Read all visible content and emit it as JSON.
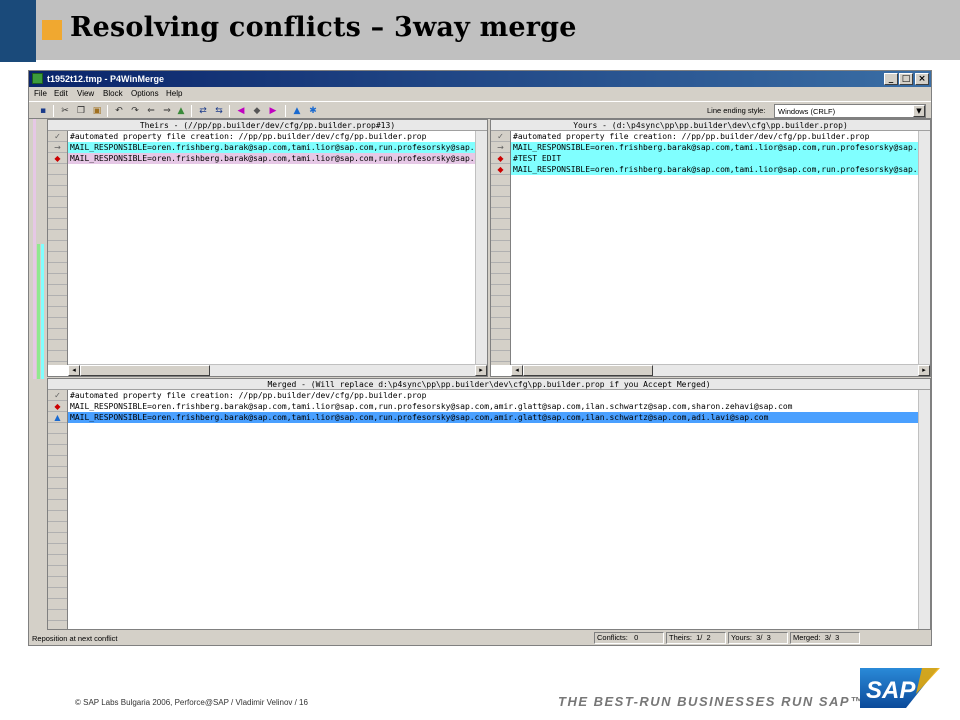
{
  "slide": {
    "title": "Resolving conflicts – 3way merge",
    "footer": "© SAP Labs Bulgaria 2006, Perforce@SAP / Vladimir Velinov / 16",
    "slogan": "THE BEST-RUN BUSINESSES RUN SAP™",
    "logo_text": "SAP",
    "colors": {
      "header_gray": "#c0c0c0",
      "header_blue": "#1a4a7a",
      "header_orange": "#f0a830",
      "sap_blue": "#1763b0",
      "sap_orange": "#f0ab00"
    }
  },
  "window": {
    "title": "t1952t12.tmp - P4WinMerge",
    "controls": {
      "minimize": "_",
      "maximize": "□",
      "close": "×"
    },
    "menu": [
      "File",
      "Edit",
      "View",
      "Block",
      "Options",
      "Help"
    ],
    "toolbar": {
      "icons": [
        "save-icon",
        "cut-icon",
        "copy-icon",
        "paste-icon",
        "undo-icon",
        "redo-icon",
        "prev-diff-icon",
        "next-diff-icon",
        "select-theirs-icon",
        "select-yours-icon",
        "prev-conflict-icon",
        "next-conflict-icon",
        "first-icon",
        "last-icon",
        "accept-icon",
        "settings-icon"
      ],
      "line_ending_label": "Line ending style:",
      "line_ending_value": "Windows (CRLF)"
    },
    "colors": {
      "changed_theirs": "#e6c8e6",
      "changed_yours": "#80ffff",
      "selected": "#4aa0ff",
      "diff_red": "#cc0000"
    }
  },
  "theirs": {
    "header": "Theirs - (//pp/pp.builder/dev/cfg/pp.builder.prop#13)",
    "lines": [
      {
        "text": "#automated property file creation: //pp/pp.builder/dev/cfg/pp.builder.prop",
        "marker": "check"
      },
      {
        "text": "MAIL_RESPONSIBLE=oren.frishberg.barak@sap.com,tami.lior@sap.com,run.profesorsky@sap.com",
        "marker": "arrow"
      },
      {
        "text": "MAIL_RESPONSIBLE=oren.frishberg.barak@sap.com,tami.lior@sap.com,run.profesorsky@sap.com",
        "marker": "diamond"
      }
    ]
  },
  "yours": {
    "header": "Yours - (d:\\p4sync\\pp\\pp.builder\\dev\\cfg\\pp.builder.prop)",
    "lines": [
      {
        "text": "#automated property file creation: //pp/pp.builder/dev/cfg/pp.builder.prop",
        "marker": "check"
      },
      {
        "text": "MAIL_RESPONSIBLE=oren.frishberg.barak@sap.com,tami.lior@sap.com,run.profesorsky@sap.com",
        "marker": "arrow"
      },
      {
        "text": "#TEST EDIT",
        "marker": "diamond"
      },
      {
        "text": "MAIL_RESPONSIBLE=oren.frishberg.barak@sap.com,tami.lior@sap.com,run.profesorsky@sap.com",
        "marker": "diamond"
      }
    ]
  },
  "merged": {
    "header": "Merged - (Will replace d:\\p4sync\\pp\\pp.builder\\dev\\cfg\\pp.builder.prop if you Accept Merged)",
    "lines": [
      {
        "text": "#automated property file creation: //pp/pp.builder/dev/cfg/pp.builder.prop",
        "marker": "check"
      },
      {
        "text": "MAIL_RESPONSIBLE=oren.frishberg.barak@sap.com,tami.lior@sap.com,run.profesorsky@sap.com,amir.glatt@sap.com,ilan.schwartz@sap.com,sharon.zehavi@sap.com",
        "marker": "diamond"
      },
      {
        "text": "MAIL_RESPONSIBLE=oren.frishberg.barak@sap.com,tami.lior@sap.com,run.profesorsky@sap.com,amir.glatt@sap.com,ilan.schwartz@sap.com,adi.lavi@sap.com",
        "marker": "triangle"
      }
    ]
  },
  "status": {
    "message": "Reposition at next conflict",
    "conflicts_label": "Conflicts:",
    "conflicts_value": "0",
    "theirs_label": "Theirs:",
    "theirs_value": "1/  2",
    "yours_label": "Yours:",
    "yours_value": "3/  3",
    "merged_label": "Merged:",
    "merged_value": "3/  3"
  }
}
